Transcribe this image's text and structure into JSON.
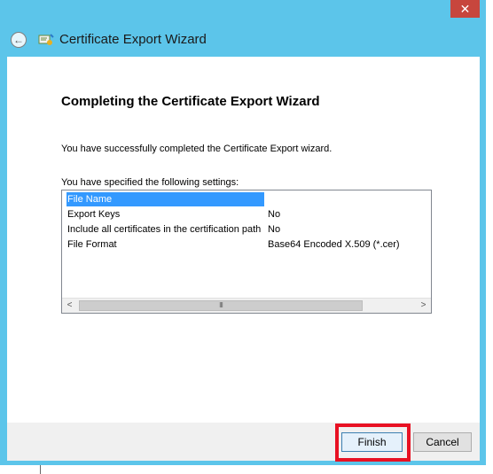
{
  "window": {
    "close_glyph": "✕",
    "title": "Certificate Export Wizard",
    "back_icon": "back-arrow-icon",
    "wizard_icon": "certificate-icon"
  },
  "content": {
    "heading": "Completing the Certificate Export Wizard",
    "success_text": "You have successfully completed the Certificate Export wizard.",
    "specified_text": "You have specified the following settings:",
    "settings": [
      {
        "key": "File Name",
        "value": ""
      },
      {
        "key": "Export Keys",
        "value": "No"
      },
      {
        "key": "Include all certificates in the certification path",
        "value": "No"
      },
      {
        "key": "File Format",
        "value": "Base64 Encoded X.509 (*.cer)"
      }
    ],
    "scroll_left": "<",
    "scroll_right": ">",
    "scroll_thumb": "III"
  },
  "buttons": {
    "finish": "Finish",
    "cancel": "Cancel"
  },
  "colors": {
    "title_bar": "#5cc5ea",
    "close": "#c7463d",
    "selection": "#3399ff",
    "highlight": "#e81123"
  }
}
